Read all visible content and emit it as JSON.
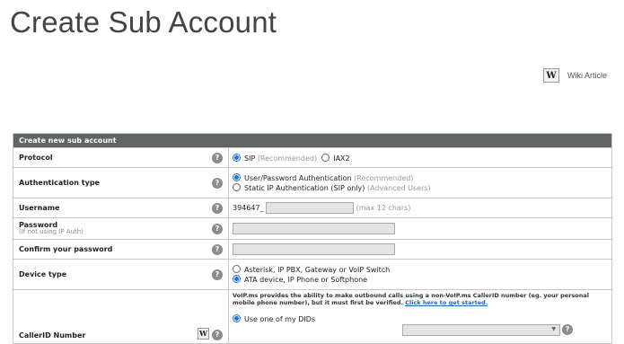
{
  "page": {
    "title": "Create Sub Account",
    "wiki_badge": "W",
    "wiki_label": "Wiki Article"
  },
  "form": {
    "header": "Create new sub account",
    "help_glyph": "?",
    "protocol": {
      "label": "Protocol",
      "option1": "SIP",
      "option1_note": "(Recommended)",
      "option2": "IAX2",
      "selected": "SIP"
    },
    "auth": {
      "label": "Authentication type",
      "option1": "User/Password Authentication",
      "option1_note": "(Recommended)",
      "option2": "Static IP Authentication (SIP only)",
      "option2_note": "(Advanced Users)",
      "selected": "User/Password Authentication"
    },
    "username": {
      "label": "Username",
      "prefix": "394647_",
      "value": "",
      "hint": "(max 12 chars)"
    },
    "password": {
      "label": "Password",
      "sublabel": "(If not using IP Auth)",
      "value": ""
    },
    "confirm": {
      "label": "Confirm your password",
      "value": ""
    },
    "device": {
      "label": "Device type",
      "option1": "Asterisk, IP PBX, Gateway or VoIP Switch",
      "option2": "ATA device, IP Phone or Softphone",
      "selected": "ATA device, IP Phone or Softphone"
    },
    "callerid": {
      "label": "CallerID Number",
      "wiki_badge": "W",
      "note": "VoIP.ms provides the ability to make outbound calls using a non-VoIP.ms CallerID number (eg. your personal mobile phone number), but it must first be verified.",
      "note_link": "Click here to get started.",
      "option1": "Use one of my DIDs",
      "select_value": ""
    }
  },
  "colors": {
    "header_bg": "#5f6660",
    "radio_selected": "#1a73e8",
    "link": "#1a66c2"
  }
}
